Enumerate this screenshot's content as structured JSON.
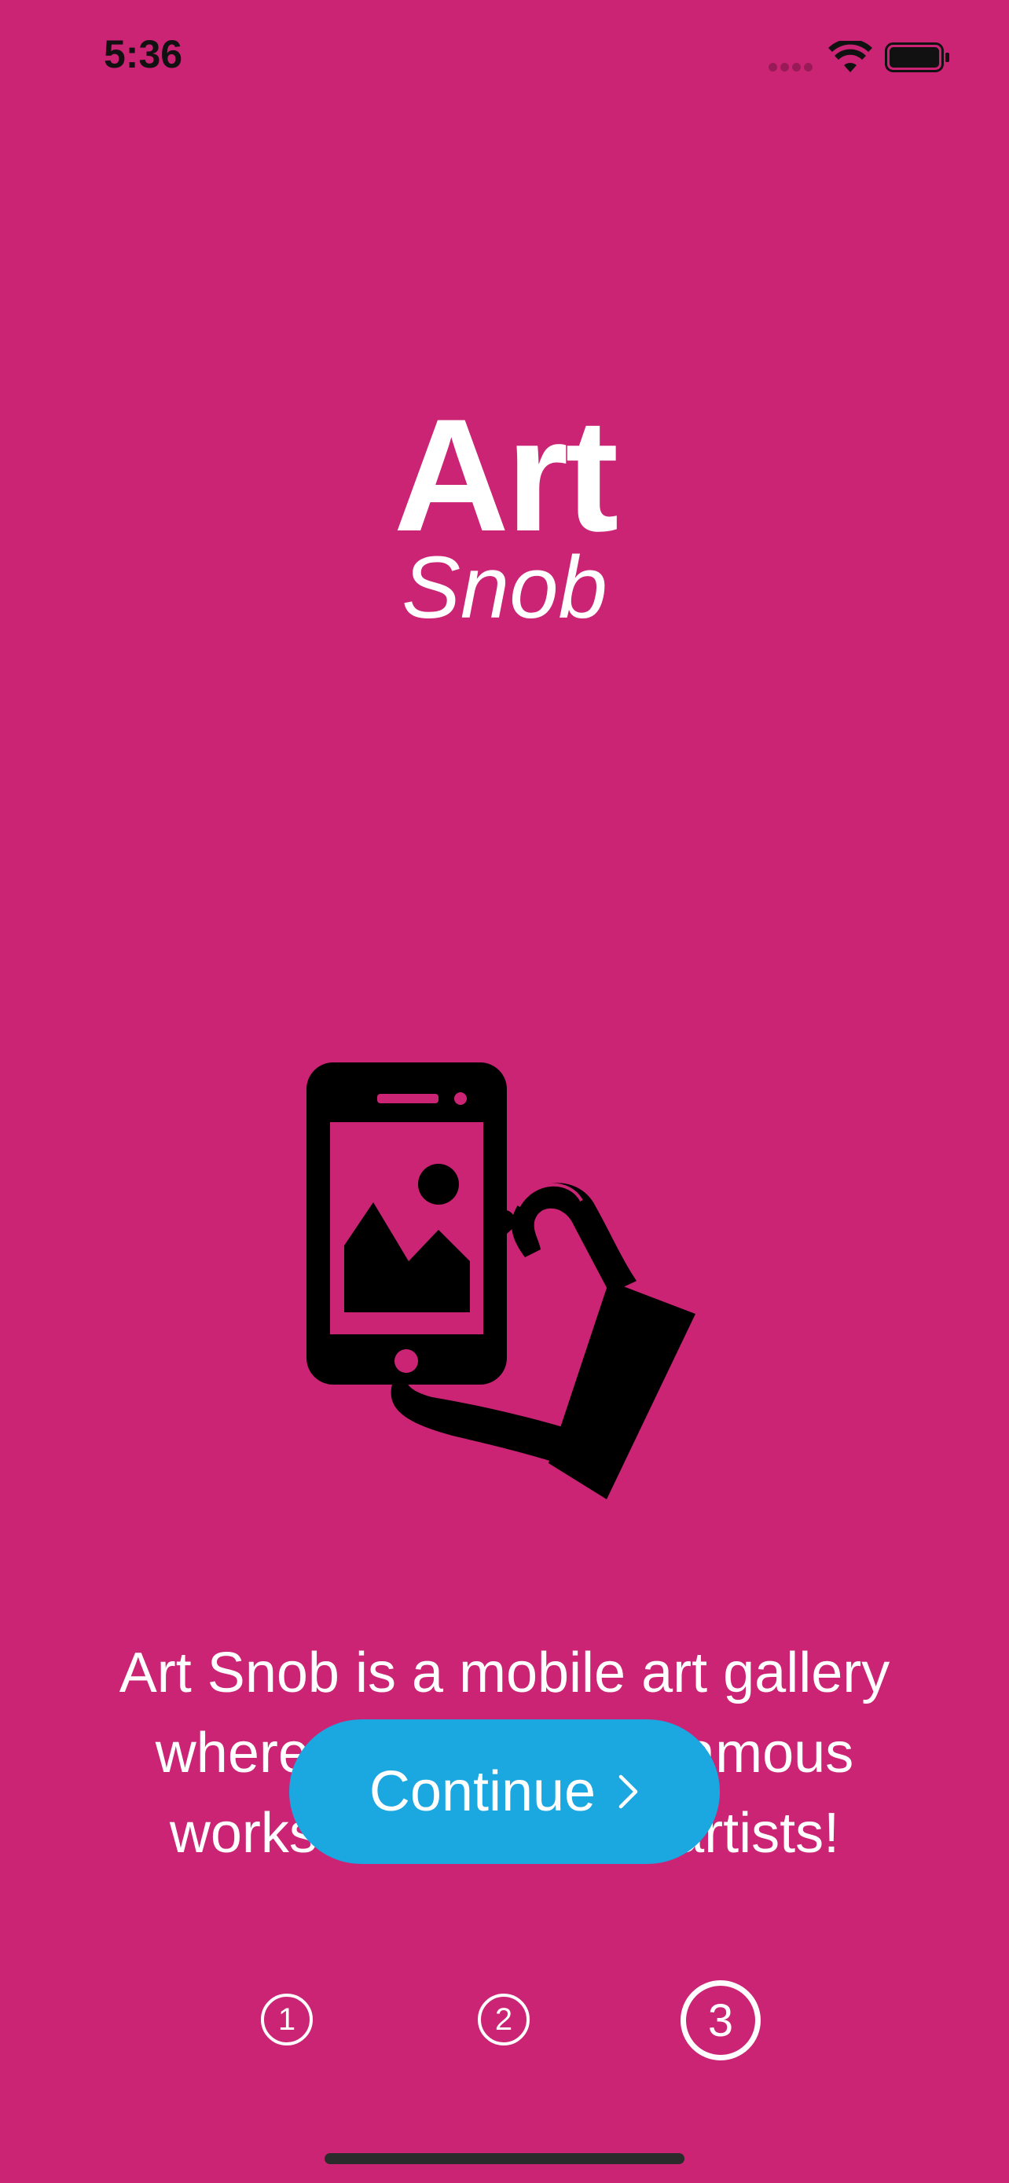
{
  "status_bar": {
    "time": "5:36",
    "wifi_icon": "wifi-icon",
    "battery_icon": "battery-full-icon"
  },
  "logo": {
    "line1": "Art",
    "line2": "Snob"
  },
  "illustration": {
    "icon": "hand-holding-phone-with-picture-icon"
  },
  "description": {
    "line1": "Art Snob is a mobile art gallery",
    "line2": "where you can view famous",
    "line3": "works by renowned artists!"
  },
  "continue_button": {
    "label": "Continue",
    "icon": "chevron-right-icon"
  },
  "pagination": {
    "pages": [
      "1",
      "2",
      "3"
    ],
    "current_page": 3
  },
  "colors": {
    "background": "#CB2474",
    "button": "#1BA7E0",
    "text": "#FFFFFF"
  }
}
